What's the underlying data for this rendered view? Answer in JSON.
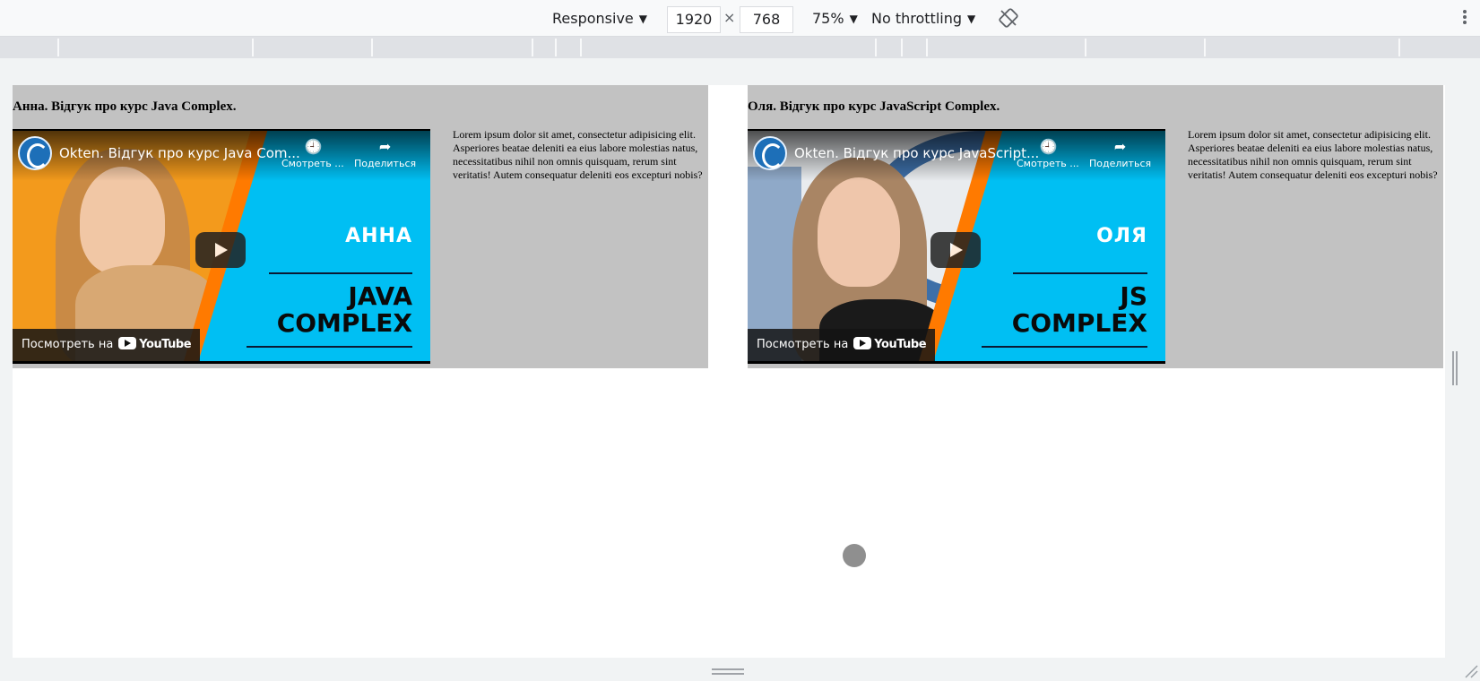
{
  "toolbar": {
    "device": "Responsive",
    "width": "1920",
    "times": "×",
    "height": "768",
    "zoom": "75%",
    "throttling": "No throttling",
    "caret": "▼"
  },
  "cards": [
    {
      "heading": "Анна. Відгук про курс Java Complex.",
      "video_title": "Okten. Відгук про курс Java Com...",
      "watch_later": "Смотреть ...",
      "share": "Поделиться",
      "name_label": "АННА",
      "big_line1": "JAVA",
      "big_line2": "COMPLEX",
      "watch_on": "Посмотреть на",
      "youtube": "YouTube",
      "text": "Lorem ipsum dolor sit amet, consectetur adipisicing elit. Asperiores beatae deleniti ea eius labore molestias natus, necessitatibus nihil non omnis quisquam, rerum sint veritatis! Autem consequatur deleniti eos excepturi nobis?"
    },
    {
      "heading": "Оля. Відгук про курс JavaScript Complex.",
      "video_title": "Okten. Відгук про курс JavaScript...",
      "watch_later": "Смотреть ...",
      "share": "Поделиться",
      "name_label": "ОЛЯ",
      "big_line1": "JS",
      "big_line2": "COMPLEX",
      "watch_on": "Посмотреть на",
      "youtube": "YouTube",
      "text": "Lorem ipsum dolor sit amet, consectetur adipisicing elit. Asperiores beatae deleniti ea eius labore molestias natus, necessitatibus nihil non omnis quisquam, rerum sint veritatis! Autem consequatur deleniti eos excepturi nobis?"
    }
  ],
  "colors": {
    "card_bg": "#c2c2c2",
    "video_accent": "#00bff3",
    "stripe": "#ff7a00",
    "left_bg_anna": "#f39a1c",
    "left_bg_olya": "#e9ecef"
  }
}
